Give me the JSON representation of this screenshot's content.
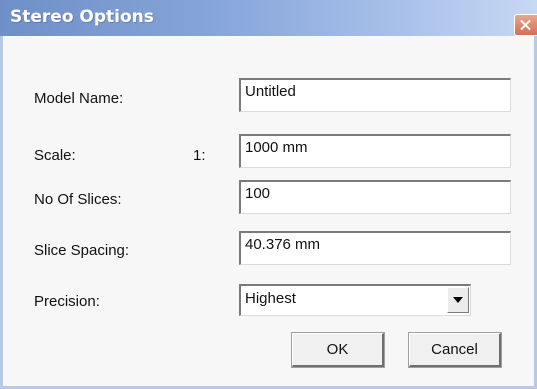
{
  "window": {
    "title": "Stereo Options",
    "close_label": "X"
  },
  "form": {
    "model_name": {
      "label": "Model Name:",
      "value": "Untitled"
    },
    "scale": {
      "label": "Scale:",
      "ratio_prefix": "1:",
      "value": "1000 mm"
    },
    "slices": {
      "label": "No Of Slices:",
      "value": "100"
    },
    "slice_spacing": {
      "label": "Slice Spacing:",
      "value": "40.376 mm"
    },
    "precision": {
      "label": "Precision:",
      "value": "Highest"
    }
  },
  "buttons": {
    "ok": "OK",
    "cancel": "Cancel"
  },
  "colors": {
    "titlebar": "#86a5da",
    "close": "#d26f53",
    "frame": "#b8c9e6"
  }
}
